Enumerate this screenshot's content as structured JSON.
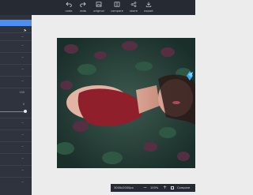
{
  "toolbar": {
    "undo": "undo",
    "redo": "redo",
    "original": "original",
    "compare": "compare",
    "share": "share",
    "export": "export"
  },
  "sidebar": {
    "values": [
      "100",
      "0"
    ]
  },
  "statusbar": {
    "dimensions": "3000x2000px",
    "zoom_out": "−",
    "zoom": "100%",
    "zoom_in": "+",
    "compare": "Compare"
  },
  "colors": {
    "topbar": "#262a33",
    "sidebar": "#2f333d",
    "accent": "#4d8ef5",
    "workspace": "#ececec"
  }
}
